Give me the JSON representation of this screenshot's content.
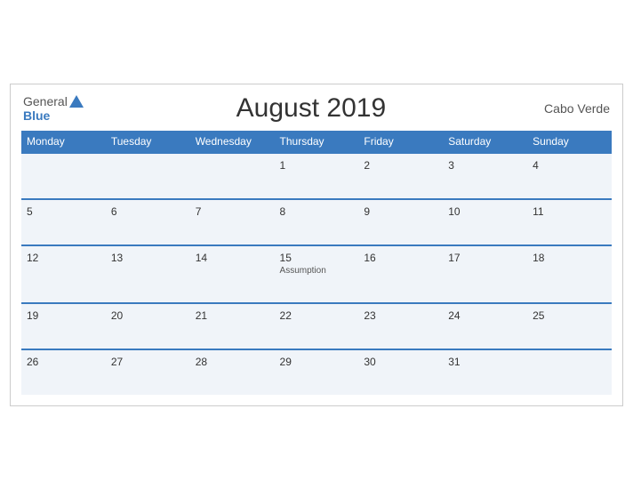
{
  "header": {
    "logo_general": "General",
    "logo_blue": "Blue",
    "title": "August 2019",
    "country": "Cabo Verde"
  },
  "weekdays": [
    "Monday",
    "Tuesday",
    "Wednesday",
    "Thursday",
    "Friday",
    "Saturday",
    "Sunday"
  ],
  "weeks": [
    [
      {
        "day": "",
        "holiday": ""
      },
      {
        "day": "",
        "holiday": ""
      },
      {
        "day": "",
        "holiday": ""
      },
      {
        "day": "1",
        "holiday": ""
      },
      {
        "day": "2",
        "holiday": ""
      },
      {
        "day": "3",
        "holiday": ""
      },
      {
        "day": "4",
        "holiday": ""
      }
    ],
    [
      {
        "day": "5",
        "holiday": ""
      },
      {
        "day": "6",
        "holiday": ""
      },
      {
        "day": "7",
        "holiday": ""
      },
      {
        "day": "8",
        "holiday": ""
      },
      {
        "day": "9",
        "holiday": ""
      },
      {
        "day": "10",
        "holiday": ""
      },
      {
        "day": "11",
        "holiday": ""
      }
    ],
    [
      {
        "day": "12",
        "holiday": ""
      },
      {
        "day": "13",
        "holiday": ""
      },
      {
        "day": "14",
        "holiday": ""
      },
      {
        "day": "15",
        "holiday": "Assumption"
      },
      {
        "day": "16",
        "holiday": ""
      },
      {
        "day": "17",
        "holiday": ""
      },
      {
        "day": "18",
        "holiday": ""
      }
    ],
    [
      {
        "day": "19",
        "holiday": ""
      },
      {
        "day": "20",
        "holiday": ""
      },
      {
        "day": "21",
        "holiday": ""
      },
      {
        "day": "22",
        "holiday": ""
      },
      {
        "day": "23",
        "holiday": ""
      },
      {
        "day": "24",
        "holiday": ""
      },
      {
        "day": "25",
        "holiday": ""
      }
    ],
    [
      {
        "day": "26",
        "holiday": ""
      },
      {
        "day": "27",
        "holiday": ""
      },
      {
        "day": "28",
        "holiday": ""
      },
      {
        "day": "29",
        "holiday": ""
      },
      {
        "day": "30",
        "holiday": ""
      },
      {
        "day": "31",
        "holiday": ""
      },
      {
        "day": "",
        "holiday": ""
      }
    ]
  ]
}
